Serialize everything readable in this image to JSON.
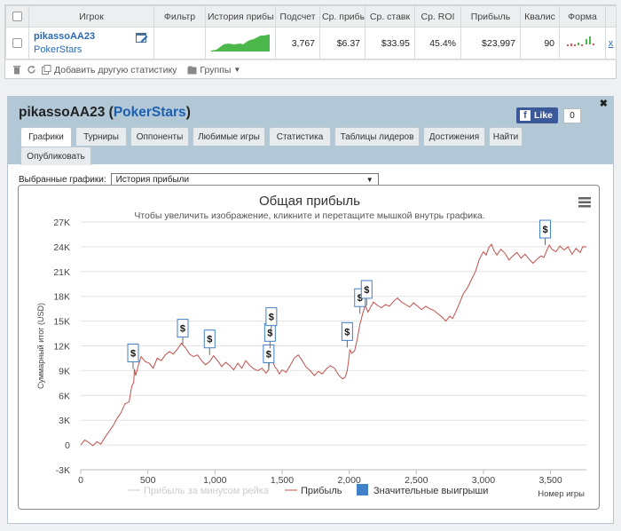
{
  "stats_table": {
    "headers": [
      "Игрок",
      "Фильтр",
      "История прибы",
      "Подсчет",
      "Ср. прибы",
      "Ср. ставк",
      "Ср. ROI",
      "Прибыль",
      "Квалис",
      "Форма"
    ],
    "row": {
      "player": "pikassoAA23",
      "site": "PokerStars",
      "count": "3,767",
      "avg_profit": "$6.37",
      "avg_stake": "$33.95",
      "avg_roi": "45.4%",
      "profit": "$23,997",
      "quali": "90",
      "remove": "x"
    },
    "accent_green": "#4cb84c"
  },
  "toolbar": {
    "add_stats": "Добавить другую статистику",
    "groups": "Группы"
  },
  "panel": {
    "player": "pikassoAA23",
    "open_paren": " (",
    "site": "PokerStars",
    "close_paren": ")",
    "close": "✖",
    "fb_like": "Like",
    "fb_count": "0",
    "tabs": [
      "Графики",
      "Турниры",
      "Оппоненты",
      "Любимые игры",
      "Статистика",
      "Таблицы лидеров",
      "Достижения",
      "Найти",
      "Опубликовать"
    ],
    "active_tab": "Графики",
    "select_label": "Выбранные графики:",
    "select_value": "История прибыли"
  },
  "chart_data": {
    "type": "line",
    "title": "Общая прибыль",
    "subtitle": "Чтобы увеличить изображение, кликните и перетащите мышкой внутрь графика.",
    "ylabel": "Суммарный итог (USD)",
    "xlabel": "Номер игры",
    "xlim": [
      0,
      3767
    ],
    "ylim": [
      -3000,
      27000
    ],
    "x_ticks": [
      "0",
      "500",
      "1,000",
      "1,500",
      "2,000",
      "2,500",
      "3,000",
      "3,500"
    ],
    "y_ticks": [
      "-3K",
      "0",
      "3K",
      "6K",
      "9K",
      "12K",
      "15K",
      "18K",
      "21K",
      "24K",
      "27K"
    ],
    "grid": true,
    "legend": "bottom",
    "series": [
      {
        "name": "Прибыль за минусом рейка",
        "color": "#cccccc",
        "hidden": true
      },
      {
        "name": "Прибыль",
        "color": "#c0504d",
        "points": [
          [
            0,
            0
          ],
          [
            30,
            600
          ],
          [
            60,
            300
          ],
          [
            90,
            -100
          ],
          [
            120,
            400
          ],
          [
            150,
            100
          ],
          [
            180,
            900
          ],
          [
            210,
            1600
          ],
          [
            240,
            2300
          ],
          [
            270,
            3200
          ],
          [
            300,
            3900
          ],
          [
            330,
            5000
          ],
          [
            360,
            5200
          ],
          [
            380,
            7100
          ],
          [
            395,
            7600
          ],
          [
            400,
            9200
          ],
          [
            410,
            8400
          ],
          [
            430,
            9700
          ],
          [
            450,
            10700
          ],
          [
            480,
            10100
          ],
          [
            510,
            9900
          ],
          [
            540,
            9300
          ],
          [
            570,
            10500
          ],
          [
            600,
            10200
          ],
          [
            630,
            10900
          ],
          [
            660,
            11300
          ],
          [
            690,
            11000
          ],
          [
            720,
            11600
          ],
          [
            750,
            12300
          ],
          [
            780,
            11800
          ],
          [
            810,
            11000
          ],
          [
            840,
            10700
          ],
          [
            870,
            10900
          ],
          [
            900,
            10200
          ],
          [
            930,
            9700
          ],
          [
            960,
            10100
          ],
          [
            990,
            10800
          ],
          [
            1020,
            10200
          ],
          [
            1050,
            9500
          ],
          [
            1080,
            10000
          ],
          [
            1110,
            9600
          ],
          [
            1140,
            9100
          ],
          [
            1170,
            9900
          ],
          [
            1200,
            9300
          ],
          [
            1230,
            10200
          ],
          [
            1260,
            9600
          ],
          [
            1290,
            9200
          ],
          [
            1320,
            9000
          ],
          [
            1350,
            9300
          ],
          [
            1380,
            8700
          ],
          [
            1400,
            9100
          ],
          [
            1415,
            12000
          ],
          [
            1430,
            10200
          ],
          [
            1445,
            9500
          ],
          [
            1460,
            9200
          ],
          [
            1480,
            8600
          ],
          [
            1500,
            9100
          ],
          [
            1530,
            8800
          ],
          [
            1560,
            9600
          ],
          [
            1590,
            10500
          ],
          [
            1620,
            10900
          ],
          [
            1650,
            10200
          ],
          [
            1680,
            9400
          ],
          [
            1710,
            9000
          ],
          [
            1740,
            8400
          ],
          [
            1770,
            8900
          ],
          [
            1800,
            8600
          ],
          [
            1830,
            9200
          ],
          [
            1860,
            9600
          ],
          [
            1890,
            9300
          ],
          [
            1920,
            8500
          ],
          [
            1950,
            8000
          ],
          [
            1970,
            8200
          ],
          [
            1985,
            9000
          ],
          [
            1995,
            10200
          ],
          [
            2005,
            11500
          ],
          [
            2020,
            11100
          ],
          [
            2040,
            11400
          ],
          [
            2060,
            12800
          ],
          [
            2080,
            14600
          ],
          [
            2100,
            15900
          ],
          [
            2120,
            16900
          ],
          [
            2140,
            16100
          ],
          [
            2160,
            16700
          ],
          [
            2180,
            17300
          ],
          [
            2210,
            16900
          ],
          [
            2240,
            16600
          ],
          [
            2270,
            17000
          ],
          [
            2300,
            16800
          ],
          [
            2330,
            17400
          ],
          [
            2360,
            17800
          ],
          [
            2390,
            17300
          ],
          [
            2420,
            17000
          ],
          [
            2450,
            16700
          ],
          [
            2480,
            17200
          ],
          [
            2510,
            16800
          ],
          [
            2540,
            16400
          ],
          [
            2570,
            16800
          ],
          [
            2600,
            16500
          ],
          [
            2630,
            16300
          ],
          [
            2660,
            15900
          ],
          [
            2690,
            15500
          ],
          [
            2720,
            15000
          ],
          [
            2750,
            15600
          ],
          [
            2770,
            15300
          ],
          [
            2790,
            16000
          ],
          [
            2820,
            17100
          ],
          [
            2850,
            18300
          ],
          [
            2880,
            19000
          ],
          [
            2910,
            20000
          ],
          [
            2940,
            21000
          ],
          [
            2970,
            22500
          ],
          [
            3000,
            23400
          ],
          [
            3020,
            23000
          ],
          [
            3040,
            23900
          ],
          [
            3060,
            24300
          ],
          [
            3080,
            23500
          ],
          [
            3100,
            23000
          ],
          [
            3130,
            23700
          ],
          [
            3160,
            23200
          ],
          [
            3190,
            22400
          ],
          [
            3220,
            22900
          ],
          [
            3250,
            23300
          ],
          [
            3280,
            22600
          ],
          [
            3310,
            23100
          ],
          [
            3340,
            22500
          ],
          [
            3370,
            22000
          ],
          [
            3400,
            22500
          ],
          [
            3430,
            22900
          ],
          [
            3450,
            22700
          ],
          [
            3470,
            23500
          ],
          [
            3490,
            24200
          ],
          [
            3510,
            23700
          ],
          [
            3540,
            23400
          ],
          [
            3570,
            24100
          ],
          [
            3600,
            23600
          ],
          [
            3630,
            24000
          ],
          [
            3660,
            23100
          ],
          [
            3690,
            23800
          ],
          [
            3720,
            23300
          ],
          [
            3740,
            24000
          ],
          [
            3767,
            23997
          ]
        ]
      },
      {
        "name": "Значительные выигрыши",
        "color": "#3f80c8",
        "marker": "$",
        "points": [
          [
            390,
            9200
          ],
          [
            760,
            12200
          ],
          [
            960,
            10900
          ],
          [
            1400,
            9100
          ],
          [
            1410,
            11700
          ],
          [
            1420,
            13600
          ],
          [
            1985,
            11800
          ],
          [
            2080,
            15900
          ],
          [
            2130,
            16900
          ],
          [
            3460,
            24200
          ]
        ]
      }
    ]
  }
}
